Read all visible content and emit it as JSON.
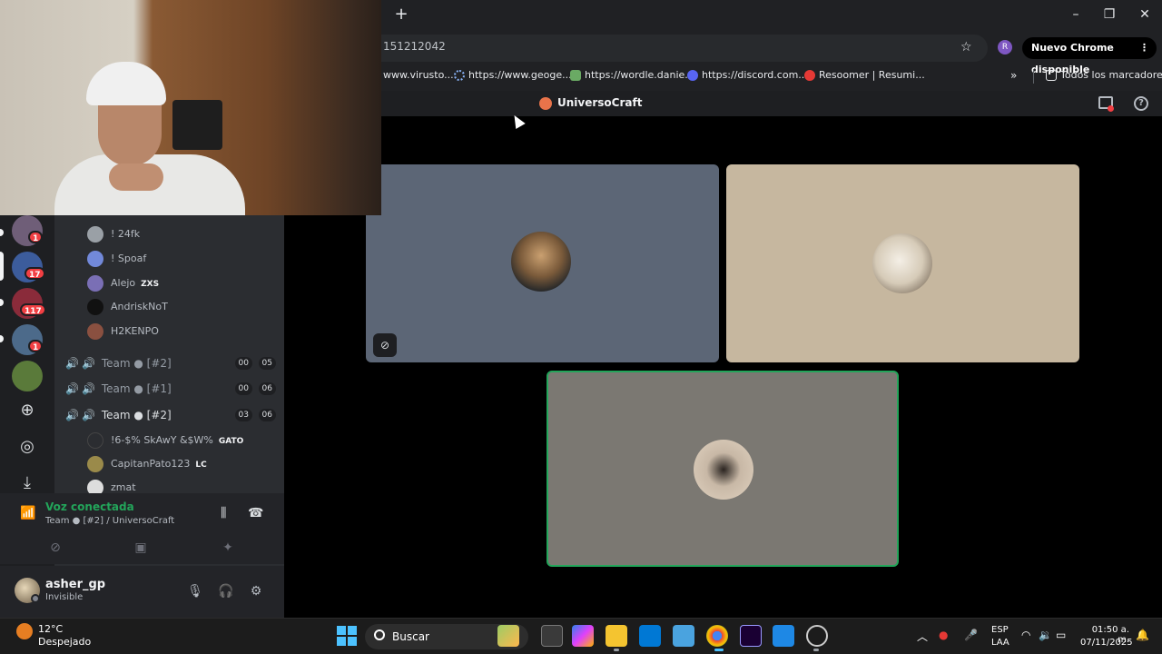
{
  "browser": {
    "url_fragment": "151212042",
    "update_button": "Nuevo Chrome disponible",
    "profile_initial": "R",
    "bookmarks": [
      {
        "label": "www.virusto...",
        "icon": "globe-icon"
      },
      {
        "label": "https://www.geoge...",
        "icon": "spinner-icon"
      },
      {
        "label": "https://wordle.danie...",
        "icon": "wordle-icon"
      },
      {
        "label": "https://discord.com...",
        "icon": "discord-icon"
      },
      {
        "label": "Resoomer | Resumi...",
        "icon": "resoomer-icon"
      }
    ],
    "all_bookmarks": "Todos los marcadores"
  },
  "discord": {
    "server_name": "UniversoCraft",
    "guild_badges": [
      "1",
      "17",
      "117",
      "1"
    ],
    "voice_users_top": [
      {
        "name": "! 24fk"
      },
      {
        "name": "! Spoaf"
      },
      {
        "name": "Alejo",
        "tag": "ZXS"
      },
      {
        "name": "AndriskNoT"
      },
      {
        "name": "H2KENPO"
      }
    ],
    "voice_channels": [
      {
        "name": "Team ● [#2]",
        "count_a": "00",
        "count_b": "05",
        "active": false
      },
      {
        "name": "Team ● [#1]",
        "count_a": "00",
        "count_b": "06",
        "active": false
      },
      {
        "name": "Team ● [#2]",
        "count_a": "03",
        "count_b": "06",
        "active": true
      }
    ],
    "voice_users_bottom": [
      {
        "name": "!6-$% SkAwY &$W%",
        "tag": "GATO"
      },
      {
        "name": "CapitanPato123",
        "tag": "LC"
      },
      {
        "name": "zmat"
      }
    ],
    "voice_panel": {
      "status": "Voz conectada",
      "channel": "Team ● [#2] / UniversoCraft"
    },
    "user": {
      "name": "asher_gp",
      "status": "Invisible"
    }
  },
  "taskbar": {
    "weather_temp": "12°C",
    "weather_desc": "Despejado",
    "search_placeholder": "Buscar",
    "lang_line1": "ESP",
    "lang_line2": "LAA",
    "time": "01:50 a. m.",
    "date": "07/11/2025"
  },
  "colors": {
    "discord_green": "#23a55a",
    "badge_red": "#f23f43",
    "chrome_bg": "#202124"
  }
}
